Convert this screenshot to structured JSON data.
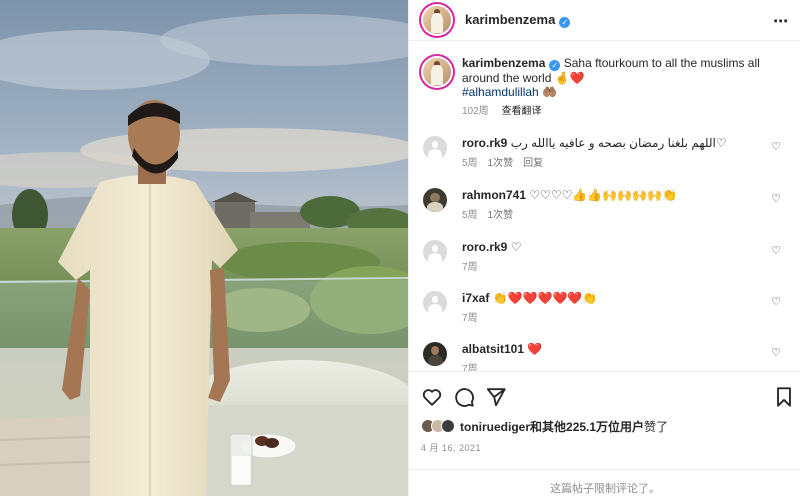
{
  "post": {
    "username": "karimbenzema",
    "verified_icon": "verified-badge-icon",
    "more_icon": "more-horizontal-icon"
  },
  "caption": {
    "username": "karimbenzema",
    "text": "Saha ftourkoum to all the muslims all around the world 🤞❤️",
    "hashtag": "#alhamdulillah 🤲🏽",
    "time": "102周",
    "translate": "查看翻译"
  },
  "comments": [
    {
      "username": "roro.rk9",
      "text": "اللهم بلغنا رمضان بصحه و عافيه ياالله رب♡",
      "time": "5周",
      "likes": "1次赞",
      "reply": "回复",
      "avatar": "default-avatar"
    },
    {
      "username": "rahmon741",
      "text": "♡♡♡♡👍👍🙌🙌🙌🙌👏",
      "time": "5周",
      "likes": "1次赞",
      "reply": "",
      "avatar": "photo-avatar"
    },
    {
      "username": "roro.rk9",
      "text": "♡",
      "time": "7周",
      "likes": "",
      "reply": "",
      "avatar": "default-avatar"
    },
    {
      "username": "i7xaf",
      "text": "👏❤️❤️❤️❤️❤️👏",
      "time": "7周",
      "likes": "",
      "reply": "",
      "avatar": "default-avatar"
    },
    {
      "username": "albatsit101",
      "text": "❤️",
      "time": "7周",
      "likes": "",
      "reply": "",
      "avatar": "photo-avatar"
    }
  ],
  "actions": {
    "like_icon": "heart-icon",
    "comment_icon": "comment-icon",
    "share_icon": "send-icon",
    "save_icon": "bookmark-icon"
  },
  "likes": {
    "text_pre": "toniruediger和",
    "text_count": "其他225.1万位用户",
    "text_post": "赞了"
  },
  "date": "4 月 16, 2021",
  "footer": "这篇帖子限制评论了。"
}
